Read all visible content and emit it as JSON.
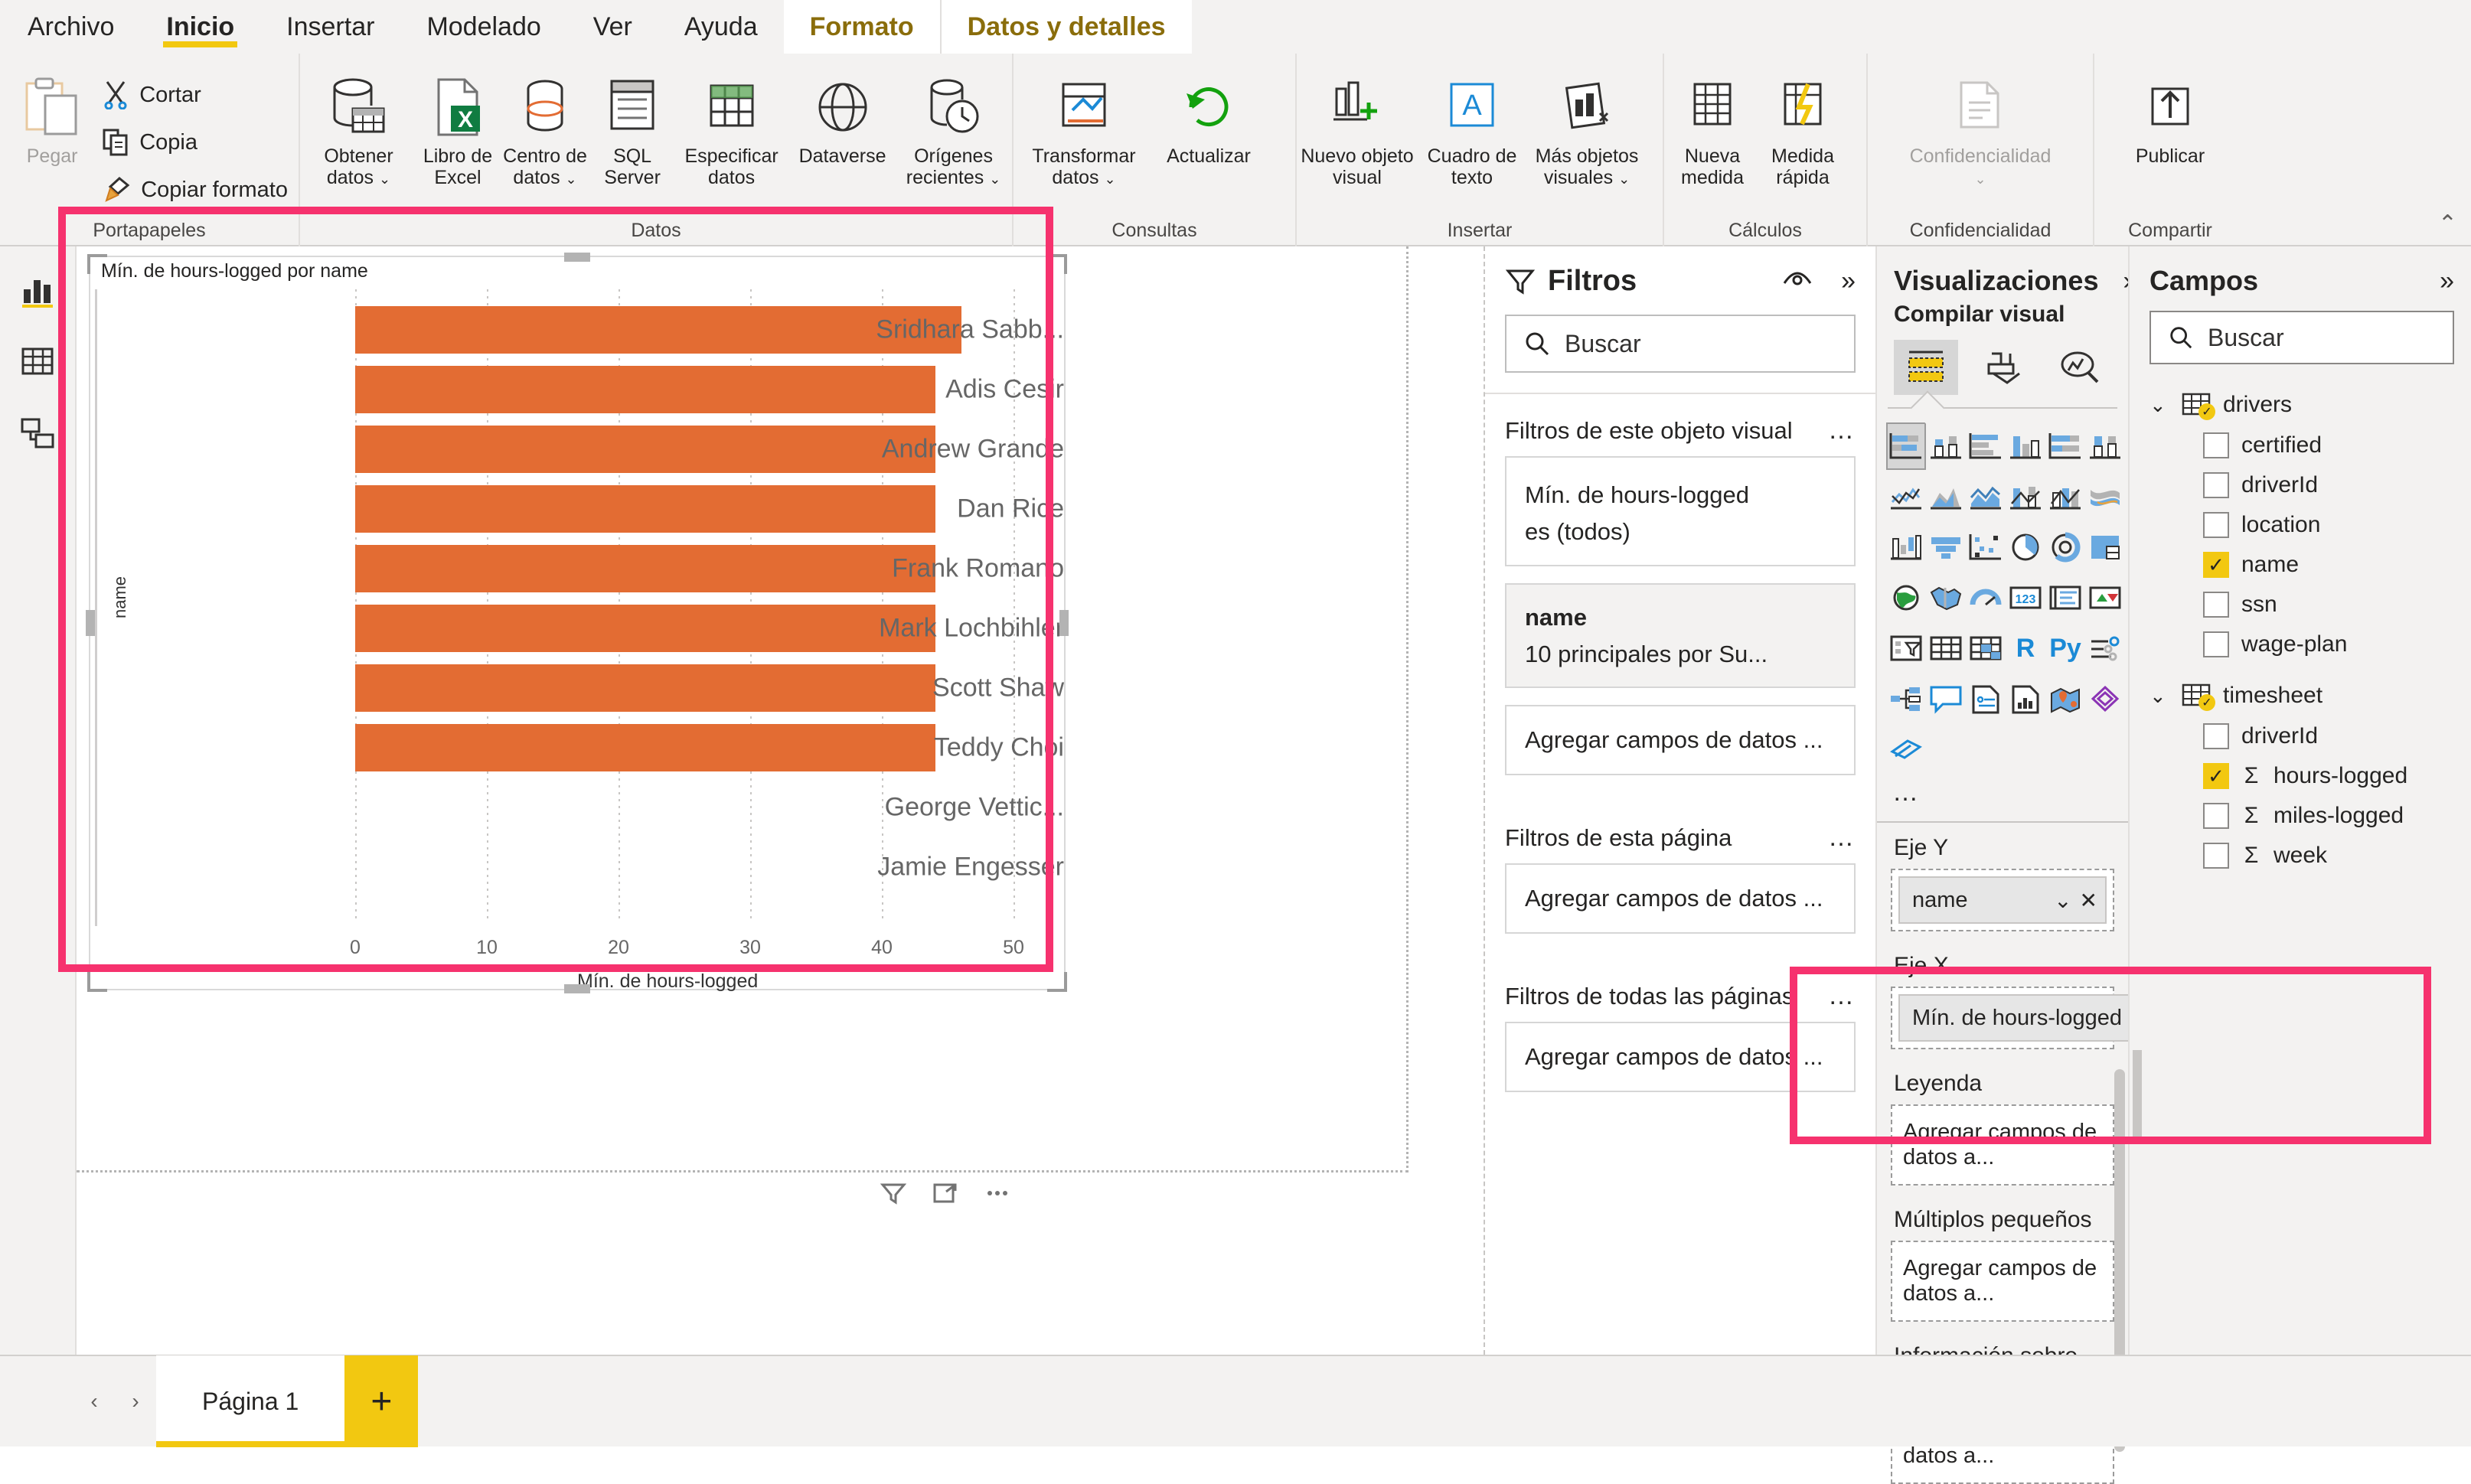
{
  "ribbon": {
    "tabs": [
      {
        "label": "Archivo",
        "state": "normal"
      },
      {
        "label": "Inicio",
        "state": "active"
      },
      {
        "label": "Insertar",
        "state": "normal"
      },
      {
        "label": "Modelado",
        "state": "normal"
      },
      {
        "label": "Ver",
        "state": "normal"
      },
      {
        "label": "Ayuda",
        "state": "normal"
      },
      {
        "label": "Formato",
        "state": "contextual"
      },
      {
        "label": "Datos y detalles",
        "state": "contextual"
      }
    ],
    "groups": [
      {
        "label": "Portapapeles",
        "big": [
          {
            "label": "Pegar",
            "icon": "paste-icon",
            "disabled": true
          }
        ],
        "small": [
          {
            "label": "Cortar",
            "icon": "cut-icon"
          },
          {
            "label": "Copia",
            "icon": "copy-icon"
          },
          {
            "label": "Copiar formato",
            "icon": "format-painter-icon"
          }
        ]
      },
      {
        "label": "Datos",
        "big": [
          {
            "label": "Obtener datos",
            "icon": "get-data-icon",
            "caret": true
          },
          {
            "label": "Libro de Excel",
            "icon": "excel-icon"
          },
          {
            "label": "Centro de datos",
            "icon": "datahub-icon",
            "caret": true
          },
          {
            "label": "SQL Server",
            "icon": "sql-server-icon"
          },
          {
            "label": "Especificar datos",
            "icon": "enter-data-icon"
          },
          {
            "label": "Dataverse",
            "icon": "dataverse-icon"
          },
          {
            "label": "Orígenes recientes",
            "icon": "recent-sources-icon",
            "caret": true
          }
        ]
      },
      {
        "label": "Consultas",
        "big": [
          {
            "label": "Transformar datos",
            "icon": "transform-data-icon",
            "caret": true
          },
          {
            "label": "Actualizar",
            "icon": "refresh-icon"
          }
        ]
      },
      {
        "label": "Insertar",
        "big": [
          {
            "label": "Nuevo objeto visual",
            "icon": "new-visual-icon"
          },
          {
            "label": "Cuadro de texto",
            "icon": "text-box-icon"
          },
          {
            "label": "Más objetos visuales",
            "icon": "more-visuals-icon",
            "caret": true
          }
        ]
      },
      {
        "label": "Cálculos",
        "big": [
          {
            "label": "Nueva medida",
            "icon": "new-measure-icon"
          },
          {
            "label": "Medida rápida",
            "icon": "quick-measure-icon"
          }
        ]
      },
      {
        "label": "Confidencialidad",
        "big": [
          {
            "label": "Confidencialidad",
            "icon": "sensitivity-icon",
            "caret": true,
            "disabled": true
          }
        ]
      },
      {
        "label": "Compartir",
        "big": [
          {
            "label": "Publicar",
            "icon": "publish-icon"
          }
        ]
      }
    ],
    "collapse_icon": "chevron-up-icon"
  },
  "viewbar": {
    "items": [
      {
        "name": "report-view",
        "icon": "report-view-icon",
        "selected": true
      },
      {
        "name": "data-view",
        "icon": "data-view-icon",
        "selected": false
      },
      {
        "name": "model-view",
        "icon": "model-view-icon",
        "selected": false
      }
    ]
  },
  "chart_data": {
    "type": "bar",
    "orientation": "horizontal",
    "title": "Mín. de hours-logged por name",
    "xlabel": "Mín. de hours-logged",
    "ylabel": "name",
    "xlim": [
      0,
      50
    ],
    "xticks": [
      0,
      10,
      20,
      30,
      40,
      50
    ],
    "grid": true,
    "legend": null,
    "bar_color": "#E36C33",
    "categories": [
      "Sridhara Sabb...",
      "Adis Cesir",
      "Andrew Grande",
      "Dan Rice",
      "Frank Romano",
      "Mark Lochbihler",
      "Scott Shaw",
      "Teddy Choi",
      "George Vettic...",
      "Jamie Engesser"
    ],
    "values": [
      46,
      44,
      44,
      44,
      44,
      44,
      44,
      44,
      0,
      0
    ]
  },
  "visual": {
    "footer_icons": [
      "filter-icon",
      "focus-mode-icon",
      "more-options-icon"
    ]
  },
  "filters": {
    "title": "Filtros",
    "header_icons": [
      "eye-icon",
      "expand-chevrons-icon"
    ],
    "search": {
      "placeholder": "Buscar",
      "icon": "search-icon",
      "value": ""
    },
    "sections": [
      {
        "label": "Filtros de este objeto visual",
        "menu_icon": "ellipsis-icon",
        "cards": [
          {
            "title": "Mín. de hours-logged",
            "sub": "es (todos)",
            "active": false
          },
          {
            "title": "name",
            "sub": "10 principales por Su...",
            "active": true
          }
        ],
        "dropzone": "Agregar campos de datos ..."
      },
      {
        "label": "Filtros de esta página",
        "menu_icon": "ellipsis-icon",
        "cards": [],
        "dropzone": "Agregar campos de datos ..."
      },
      {
        "label": "Filtros de todas las páginas",
        "menu_icon": "ellipsis-icon",
        "cards": [],
        "dropzone": "Agregar campos de datos ..."
      }
    ]
  },
  "visualizations": {
    "title": "Visualizaciones",
    "expand_icon": "expand-chevrons-icon",
    "subtitle": "Compilar visual",
    "modes": [
      {
        "name": "build-visual-tab",
        "icon": "build-visual-icon",
        "selected": true
      },
      {
        "name": "format-visual-tab",
        "icon": "format-paintbrush-icon",
        "selected": false
      },
      {
        "name": "analytics-tab",
        "icon": "analytics-magnifier-icon",
        "selected": false
      }
    ],
    "gallery": [
      {
        "name": "stacked-bar-chart",
        "selected": true
      },
      {
        "name": "stacked-column-chart",
        "selected": false
      },
      {
        "name": "clustered-bar-chart",
        "selected": false
      },
      {
        "name": "clustered-column-chart",
        "selected": false
      },
      {
        "name": "100-stacked-bar-chart",
        "selected": false
      },
      {
        "name": "100-stacked-column-chart",
        "selected": false
      },
      {
        "name": "line-chart",
        "selected": false
      },
      {
        "name": "area-chart",
        "selected": false
      },
      {
        "name": "stacked-area-chart",
        "selected": false
      },
      {
        "name": "line-and-stacked-column-chart",
        "selected": false
      },
      {
        "name": "line-and-clustered-column-chart",
        "selected": false
      },
      {
        "name": "ribbon-chart",
        "selected": false
      },
      {
        "name": "waterfall-chart",
        "selected": false
      },
      {
        "name": "funnel-chart",
        "selected": false
      },
      {
        "name": "scatter-chart",
        "selected": false
      },
      {
        "name": "pie-chart",
        "selected": false
      },
      {
        "name": "donut-chart",
        "selected": false
      },
      {
        "name": "treemap-chart",
        "selected": false
      },
      {
        "name": "map-visual",
        "selected": false
      },
      {
        "name": "filled-map-visual",
        "selected": false
      },
      {
        "name": "gauge-visual",
        "selected": false
      },
      {
        "name": "card-visual",
        "selected": false
      },
      {
        "name": "multi-row-card-visual",
        "selected": false
      },
      {
        "name": "kpi-visual",
        "selected": false
      },
      {
        "name": "slicer-visual",
        "selected": false
      },
      {
        "name": "table-visual",
        "selected": false
      },
      {
        "name": "matrix-visual",
        "selected": false
      },
      {
        "name": "r-script-visual",
        "label": "R",
        "selected": false
      },
      {
        "name": "python-visual",
        "label": "Py",
        "selected": false
      },
      {
        "name": "key-influencers-visual",
        "selected": false
      },
      {
        "name": "decomposition-tree-visual",
        "selected": false
      },
      {
        "name": "q-and-a-visual",
        "selected": false
      },
      {
        "name": "smart-narrative-visual",
        "selected": false
      },
      {
        "name": "paginated-report-visual",
        "selected": false
      },
      {
        "name": "azure-map-visual",
        "selected": false
      },
      {
        "name": "power-apps-visual",
        "selected": false
      },
      {
        "name": "power-automate-visual",
        "selected": false
      }
    ],
    "more_icon": "ellipsis-icon",
    "wells": [
      {
        "label": "Eje Y",
        "chip": {
          "name": "name",
          "caret_icon": "chevron-down-icon",
          "remove_icon": "close-icon"
        },
        "placeholder": null
      },
      {
        "label": "Eje X",
        "chip": {
          "name": "Mín. de hours-logged",
          "caret_icon": "chevron-down-icon",
          "remove_icon": "close-icon"
        },
        "placeholder": null
      },
      {
        "label": "Leyenda",
        "chip": null,
        "placeholder": "Agregar campos de datos a..."
      },
      {
        "label": "Múltiplos pequeños",
        "chip": null,
        "placeholder": "Agregar campos de datos a..."
      },
      {
        "label": "Información sobre herramien...",
        "chip": null,
        "placeholder": "Agregar campos de datos a..."
      }
    ]
  },
  "campos": {
    "title": "Campos",
    "expand_icon": "expand-chevrons-icon",
    "search": {
      "placeholder": "Buscar",
      "icon": "search-icon",
      "value": ""
    },
    "tables": [
      {
        "name": "drivers",
        "expanded": true,
        "icon": "table-icon",
        "badge": "check-badge-icon",
        "fields": [
          {
            "name": "certified",
            "checked": false,
            "aggregate": false
          },
          {
            "name": "driverId",
            "checked": false,
            "aggregate": false
          },
          {
            "name": "location",
            "checked": false,
            "aggregate": false
          },
          {
            "name": "name",
            "checked": true,
            "aggregate": false
          },
          {
            "name": "ssn",
            "checked": false,
            "aggregate": false
          },
          {
            "name": "wage-plan",
            "checked": false,
            "aggregate": false
          }
        ]
      },
      {
        "name": "timesheet",
        "expanded": true,
        "icon": "table-icon",
        "badge": "check-badge-icon",
        "fields": [
          {
            "name": "driverId",
            "checked": false,
            "aggregate": false
          },
          {
            "name": "hours-logged",
            "checked": true,
            "aggregate": true
          },
          {
            "name": "miles-logged",
            "checked": false,
            "aggregate": true
          },
          {
            "name": "week",
            "checked": false,
            "aggregate": true
          }
        ]
      }
    ]
  },
  "pagebar": {
    "prev_icon": "chevron-left-icon",
    "next_icon": "chevron-right-icon",
    "tabs": [
      {
        "label": "Página 1",
        "active": true
      }
    ],
    "add_label": "+"
  },
  "colors": {
    "accent_yellow": "#f2c811",
    "bar_orange": "#E36C33",
    "highlight_pink": "#F6326E",
    "contextual_tab": "#8a6d0b",
    "ribbon_bg": "#f3f2f1"
  }
}
